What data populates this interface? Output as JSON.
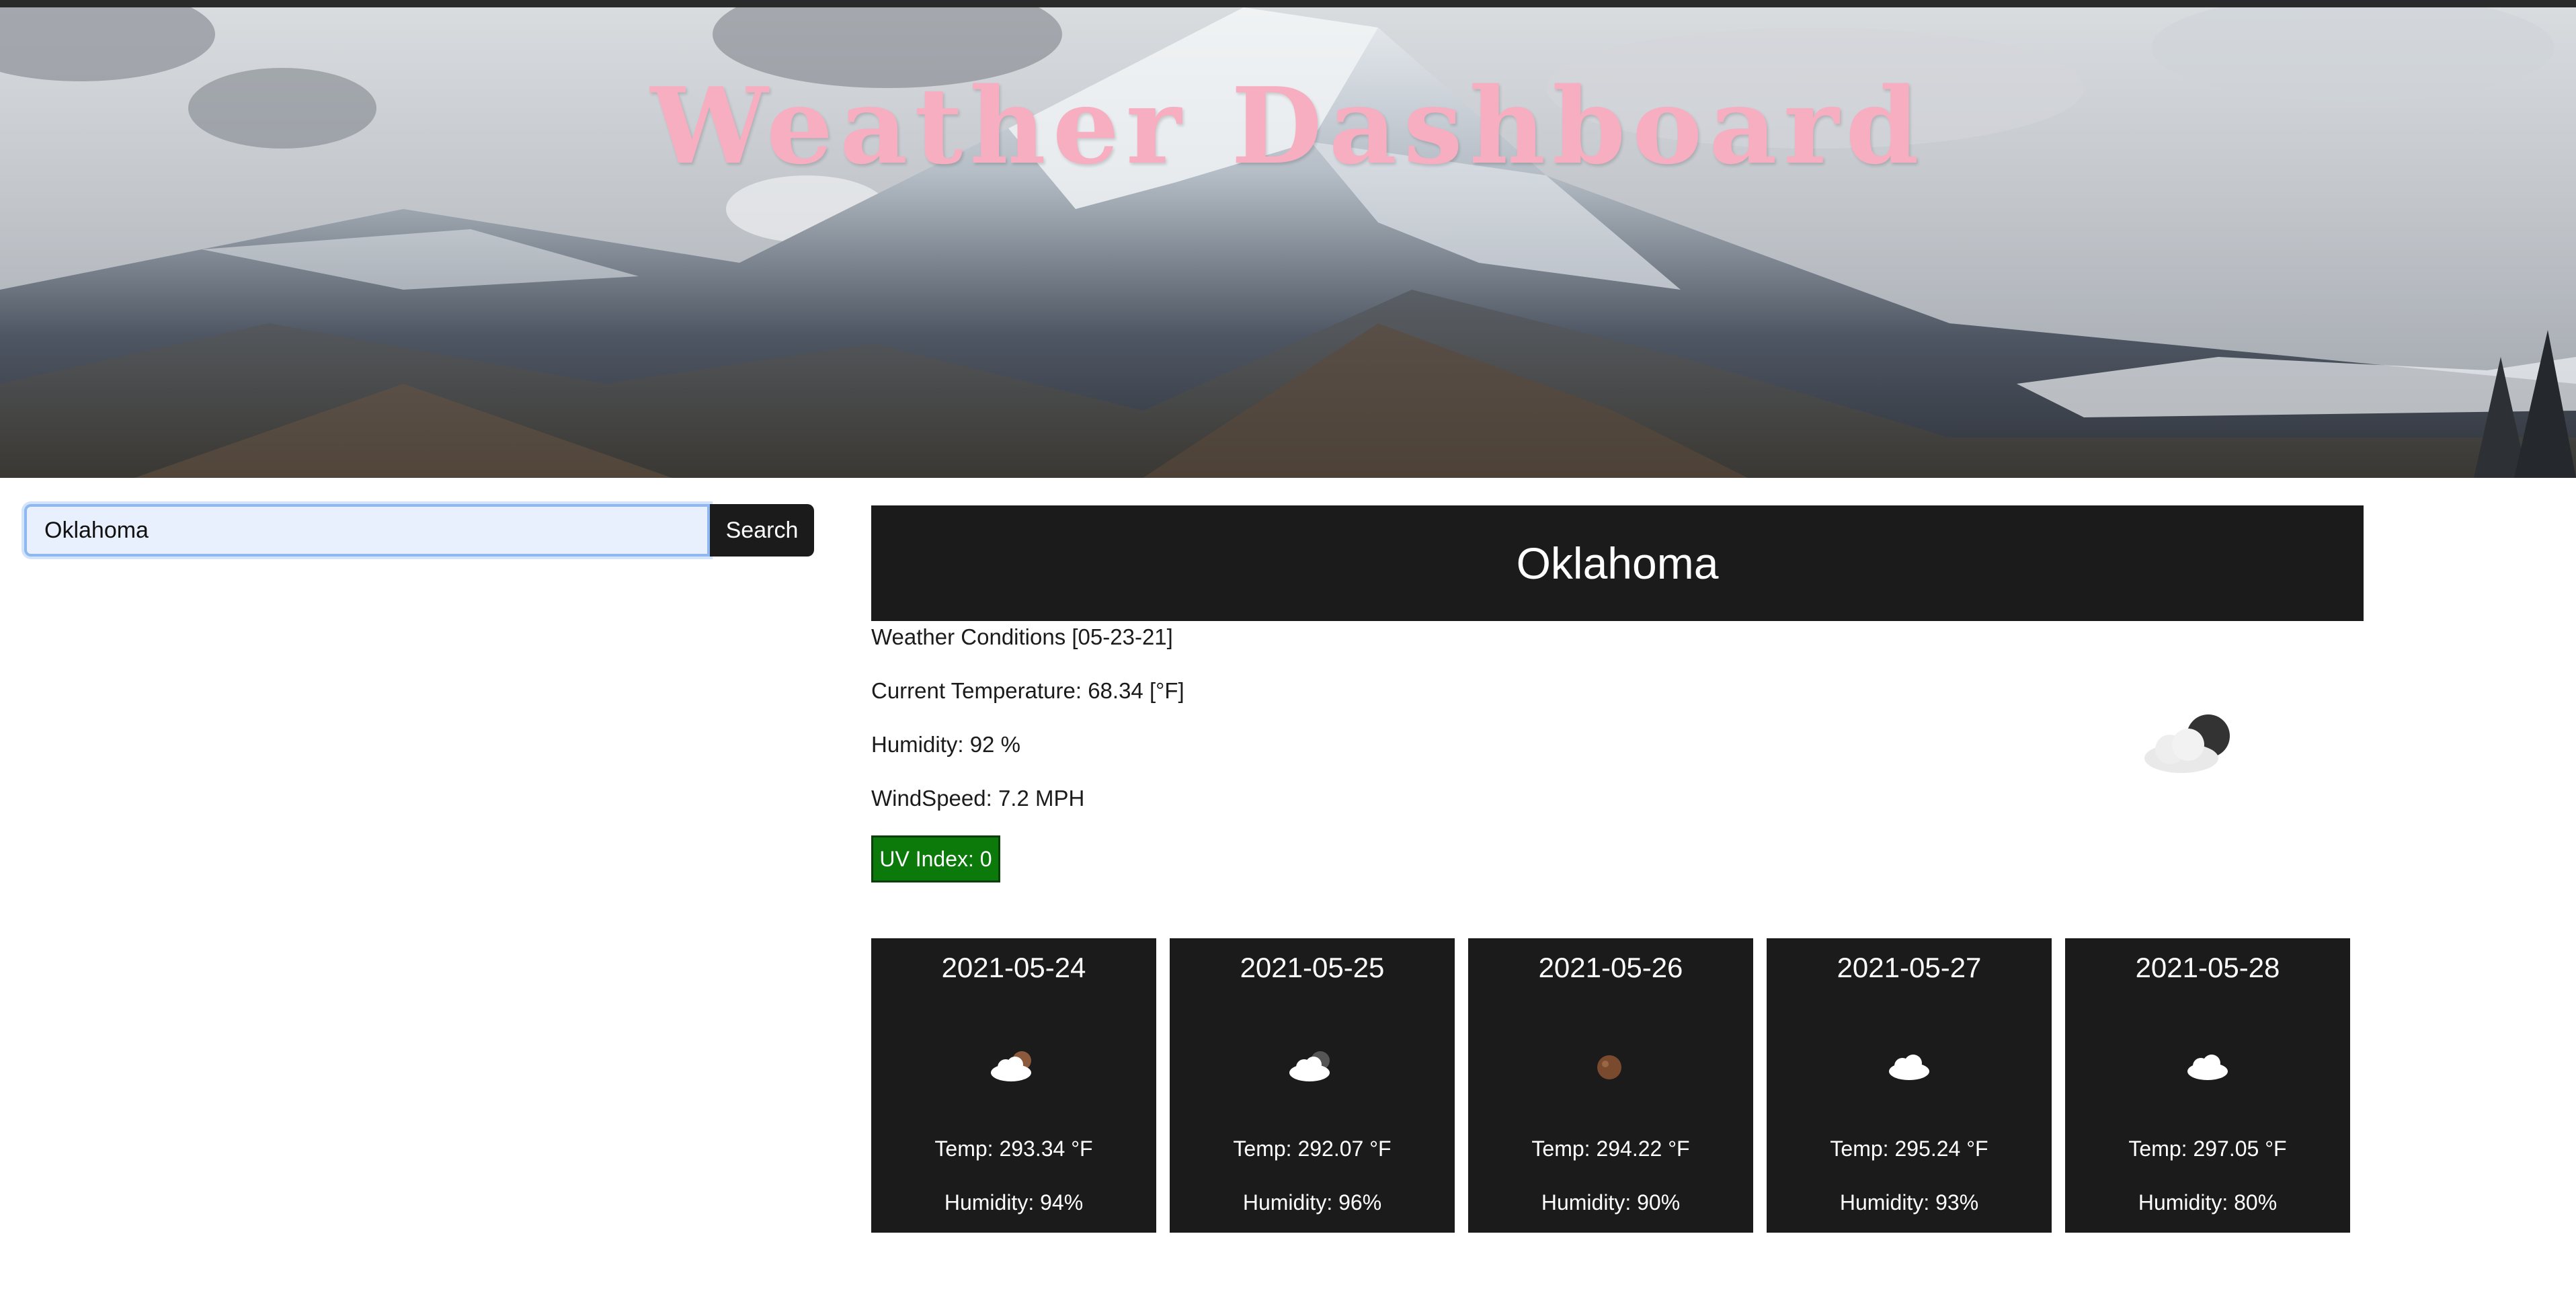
{
  "header": {
    "title": "Weather Dashboard"
  },
  "search": {
    "value": "Oklahoma",
    "button_label": "Search"
  },
  "current": {
    "city": "Oklahoma",
    "conditions": "Weather Conditions [05-23-21]",
    "temperature": "Current Temperature: 68.34 [°F]",
    "humidity": "Humidity: 92 %",
    "wind": "WindSpeed: 7.2 MPH",
    "uv": "UV Index: 0",
    "icon": "cloud-moon-icon",
    "uv_color": "#0b7a0b"
  },
  "forecast": [
    {
      "date": "2021-05-24",
      "icon": "cloud-moon-icon",
      "temp": "Temp: 293.34 °F",
      "humidity": "Humidity: 94%"
    },
    {
      "date": "2021-05-25",
      "icon": "cloud-moon-icon",
      "temp": "Temp: 292.07 °F",
      "humidity": "Humidity: 96%"
    },
    {
      "date": "2021-05-26",
      "icon": "moon-icon",
      "temp": "Temp: 294.22 °F",
      "humidity": "Humidity: 90%"
    },
    {
      "date": "2021-05-27",
      "icon": "cloud-icon",
      "temp": "Temp: 295.24 °F",
      "humidity": "Humidity: 93%"
    },
    {
      "date": "2021-05-28",
      "icon": "cloud-icon",
      "temp": "Temp: 297.05 °F",
      "humidity": "Humidity: 80%"
    }
  ],
  "colors": {
    "title": "#f6aec0",
    "panel": "#1b1b1b",
    "uv_low": "#0b7a0b"
  }
}
